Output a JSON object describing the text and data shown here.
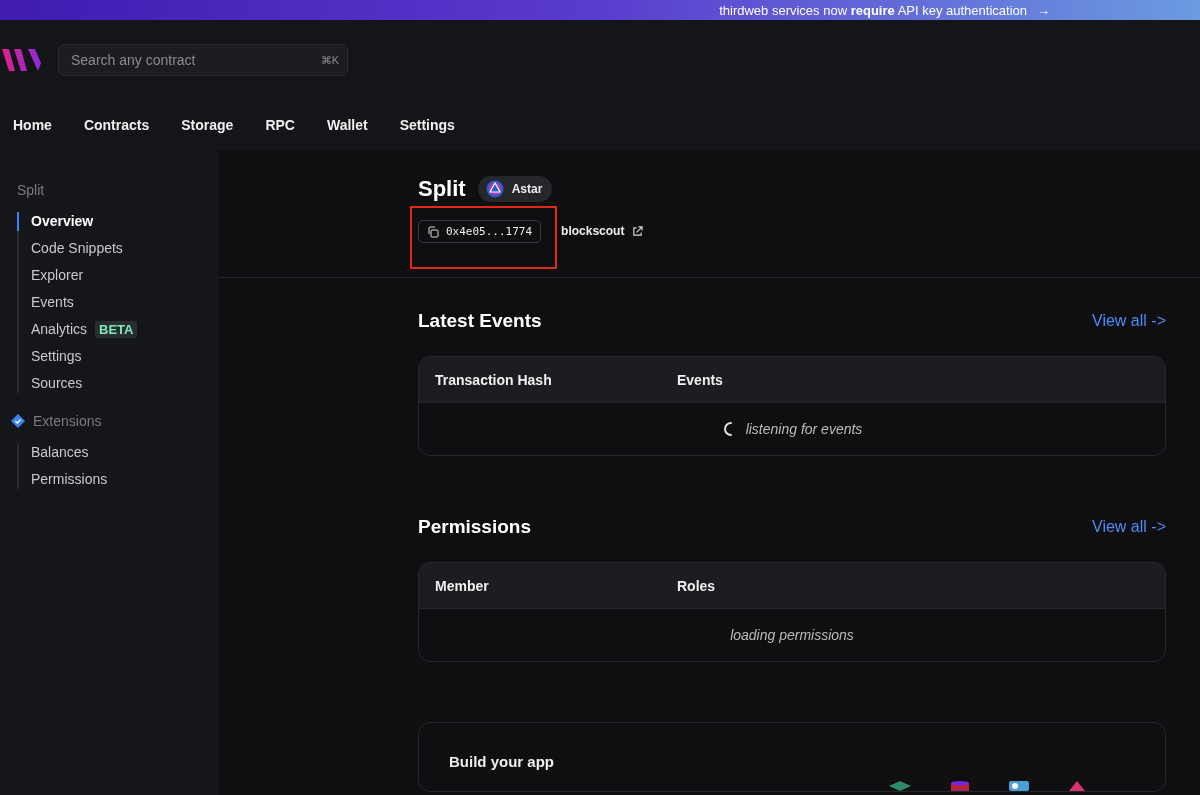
{
  "banner": {
    "text": "thirdweb services now **require** API key authentication",
    "arrow": "→"
  },
  "search": {
    "placeholder": "Search any contract",
    "shortcut": "⌘K"
  },
  "nav": [
    {
      "label": "Home",
      "selected": false
    },
    {
      "label": "Contracts",
      "selected": false
    },
    {
      "label": "Storage",
      "selected": false
    },
    {
      "label": "RPC",
      "selected": false
    },
    {
      "label": "Wallet",
      "selected": false
    },
    {
      "label": "Settings",
      "selected": false
    }
  ],
  "sidebar": {
    "title": "Split",
    "items": [
      {
        "label": "Overview",
        "selected": true
      },
      {
        "label": "Code Snippets",
        "selected": false
      },
      {
        "label": "Explorer",
        "selected": false
      },
      {
        "label": "Events",
        "selected": false
      },
      {
        "label": "Analytics",
        "selected": false,
        "badge": "BETA"
      },
      {
        "label": "Settings",
        "selected": false
      },
      {
        "label": "Sources",
        "selected": false
      }
    ],
    "extensions_title": "Extensions",
    "extensions": [
      {
        "label": "Balances",
        "selected": false
      },
      {
        "label": "Permissions",
        "selected": false
      }
    ]
  },
  "contract": {
    "name": "Split",
    "chain": "Astar",
    "address": "0x4e05...1774",
    "explorer": "blockscout"
  },
  "sections": [
    {
      "title": "Latest Events",
      "link": "View all ->",
      "columns": [
        "Transaction Hash",
        "Events"
      ],
      "status": "listening for events",
      "spinner": true
    },
    {
      "title": "Permissions",
      "link": "View all ->",
      "columns": [
        "Member",
        "Roles"
      ],
      "status": "loading permissions",
      "spinner": false
    }
  ],
  "build": {
    "title": "Build your app"
  }
}
